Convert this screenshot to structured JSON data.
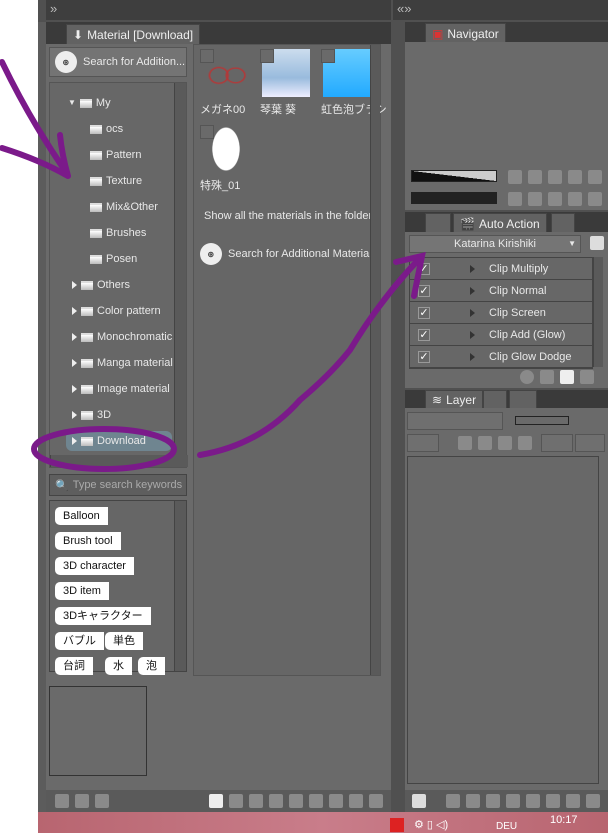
{
  "material_panel": {
    "tab_title": "Material [Download]",
    "search_additional": "Search for Addition...",
    "tree": [
      {
        "label": "My",
        "type": "open"
      },
      {
        "label": "ocs"
      },
      {
        "label": "Pattern"
      },
      {
        "label": "Texture"
      },
      {
        "label": "Mix&Other"
      },
      {
        "label": "Brushes"
      },
      {
        "label": "Posen"
      },
      {
        "label": "Others"
      },
      {
        "label": "Color pattern"
      },
      {
        "label": "Monochromatic p"
      },
      {
        "label": "Manga material"
      },
      {
        "label": "Image material"
      },
      {
        "label": "3D"
      },
      {
        "label": "Download"
      }
    ],
    "materials": [
      {
        "label": "メガネ00"
      },
      {
        "label": "琴葉 葵"
      },
      {
        "label": "虹色泡ブラシ"
      },
      {
        "label": "特殊_01"
      }
    ],
    "show_all": "Show all the materials in the folder.",
    "search_additional_full": "Search for Additional Materials",
    "keyword_placeholder": "Type search keywords",
    "tags": [
      "Balloon",
      "Brush tool",
      "3D character",
      "3D item",
      "3Dキャラクター",
      "バブル",
      "単色",
      "台詞",
      "水",
      "泡"
    ]
  },
  "navigator": {
    "tab_title": "Navigator"
  },
  "auto_action": {
    "tab_title": "Auto Action",
    "set": "Katarina Kirishiki",
    "actions": [
      "Clip Multiply",
      "Clip Normal",
      "Clip Screen",
      "Clip Add (Glow)",
      "Clip Glow Dodge"
    ]
  },
  "layer": {
    "tab_title": "Layer"
  },
  "taskbar": {
    "time": "10:17",
    "lang": "DEU"
  },
  "colors": {
    "annotation": "#7b1a8a",
    "panel": "#6a6a6a",
    "taskbar": "#c0707c"
  }
}
